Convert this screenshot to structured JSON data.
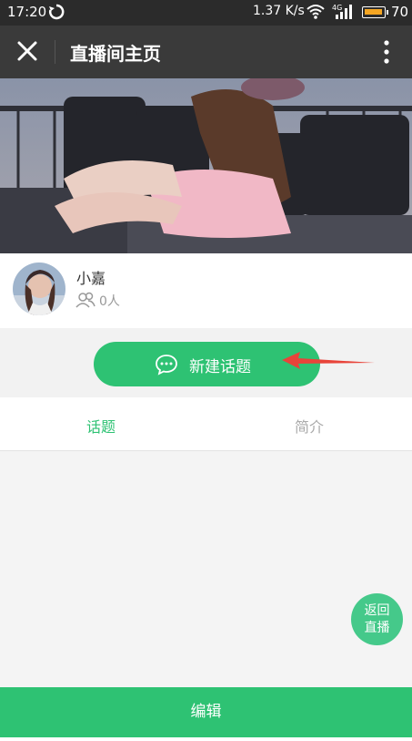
{
  "status_bar": {
    "time": "17:20",
    "speed": "1.37 K/s",
    "network": "4G",
    "battery": "70"
  },
  "nav": {
    "title": "直播间主页"
  },
  "profile": {
    "name": "小嘉",
    "followers": "0人"
  },
  "actions": {
    "new_topic": "新建话题"
  },
  "tabs": [
    {
      "label": "话题",
      "active": true
    },
    {
      "label": "简介",
      "active": false
    }
  ],
  "float_button": {
    "line1": "返回",
    "line2": "直播"
  },
  "bottom": {
    "edit_label": "编辑"
  },
  "colors": {
    "accent": "#2ec273",
    "nav_bg": "#3a3a3a",
    "annotation_arrow": "#e8443a"
  }
}
